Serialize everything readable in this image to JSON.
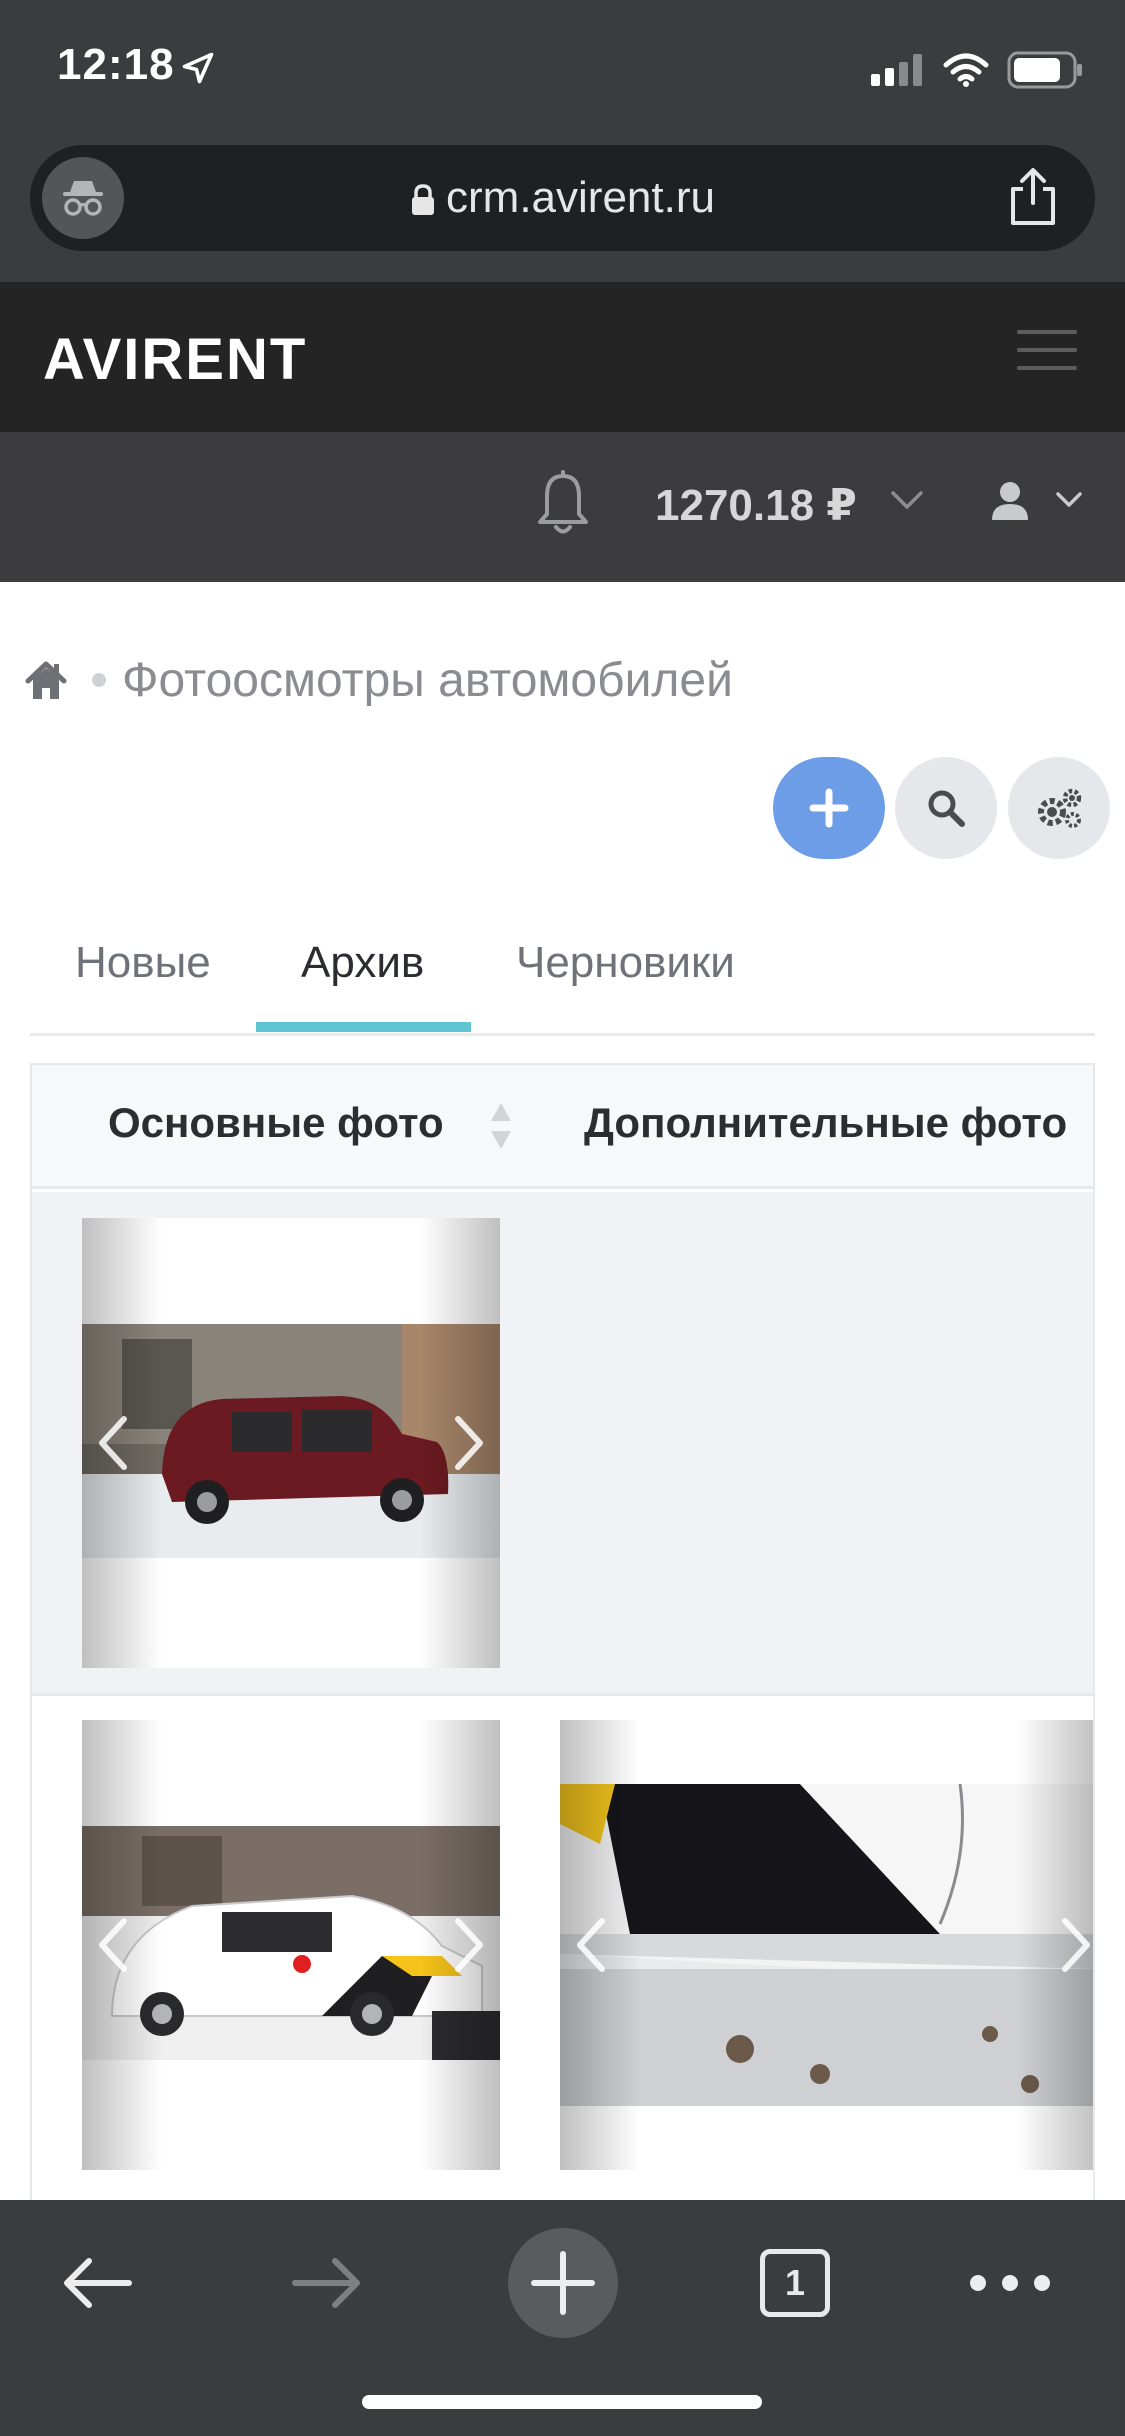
{
  "status": {
    "time": "12:18"
  },
  "browser": {
    "url": "crm.avirent.ru"
  },
  "header": {
    "brand": "AVIRENT"
  },
  "subheader": {
    "balance": "1270.18 ₽"
  },
  "breadcrumb": {
    "title": "Фотоосмотры автомобилей"
  },
  "tabs": [
    {
      "label": "Новые"
    },
    {
      "label": "Архив"
    },
    {
      "label": "Черновики"
    }
  ],
  "active_tab": "Архив",
  "table": {
    "columns": [
      "Основные фото",
      "Дополнительные фото"
    ]
  },
  "bottom_bar": {
    "tab_count": "1"
  },
  "colors": {
    "accent": "#5fc5d3",
    "add_button": "#6d9de6",
    "header_bg": "#242425"
  }
}
